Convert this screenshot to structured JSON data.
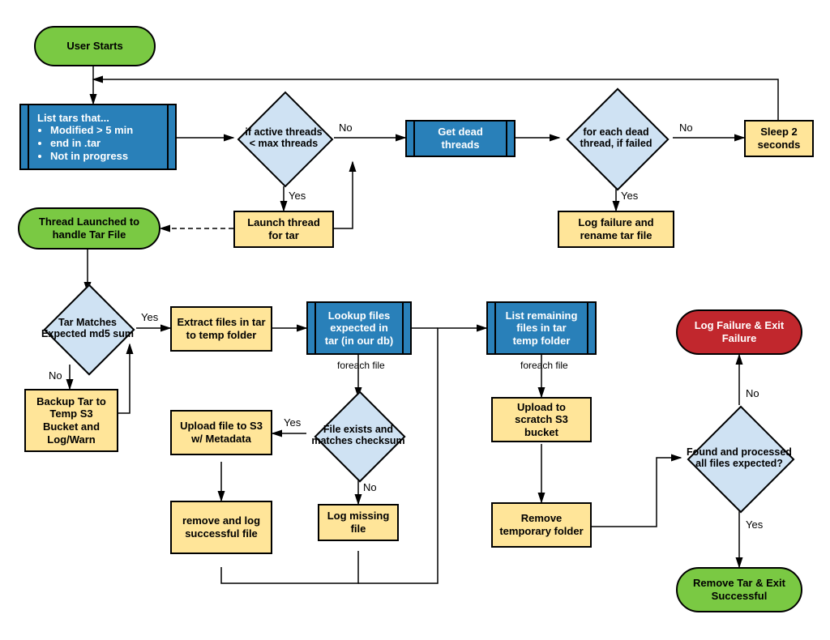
{
  "nodes": {
    "userStarts": "User Starts",
    "listTarsTitle": "List tars that...",
    "listTarsBullets": [
      "Modified > 5 min",
      "end in .tar",
      "Not in progress"
    ],
    "activeThreads": "if active threads < max threads",
    "launchThread": "Launch thread for tar",
    "getDead": "Get dead threads",
    "forEachDead": "for each dead thread, if failed",
    "logFailureRename": "Log failure and rename tar file",
    "sleep2": "Sleep 2 seconds",
    "threadLaunched": "Thread Launched to handle Tar File",
    "tarMatches": "Tar Matches Expected md5 sum",
    "backupTar": "Backup Tar to Temp S3 Bucket and Log/Warn",
    "extractFiles": "Extract files in tar to temp folder",
    "lookupFiles": "Lookup files expected in tar (in our db)",
    "fileExists": "File exists and matches checksum",
    "uploadS3Meta": "Upload file to S3 w/ Metadata",
    "removeLogSuccess": "remove and log successful file",
    "logMissing": "Log missing file",
    "listRemaining": "List remaining files in tar temp folder",
    "uploadScratch": "Upload to scratch S3 bucket",
    "removeTemp": "Remove temporary folder",
    "foundProcessed": "Found and processed all files expected?",
    "logFailureExit": "Log Failure & Exit Failure",
    "removeTarExit": "Remove Tar & Exit Successful"
  },
  "labels": {
    "yes": "Yes",
    "no": "No",
    "foreachFile": "foreach file"
  },
  "colors": {
    "green": "#7ac943",
    "red": "#c1272d",
    "blue": "#2980b9",
    "lightblue": "#cfe2f3",
    "yellow": "#ffe599"
  }
}
